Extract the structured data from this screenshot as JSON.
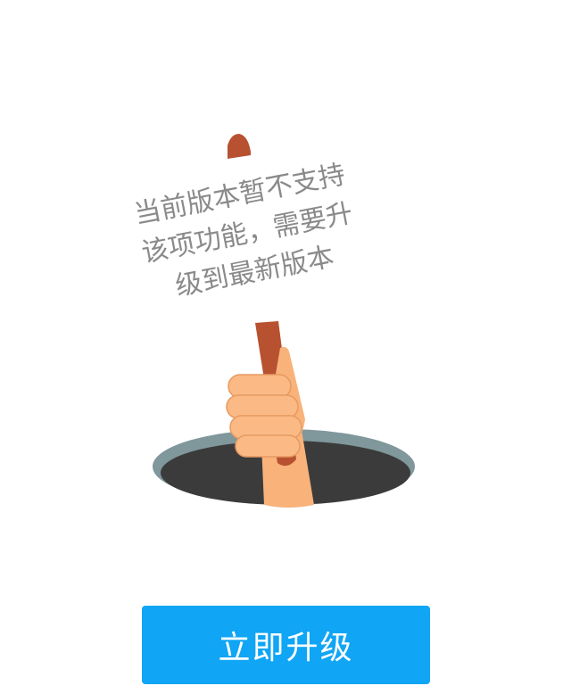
{
  "illustration": {
    "icon": "hand-holding-sign-from-hole",
    "sign_lines": [
      "当前版本暂不支持",
      "该项功能，需要升",
      "级到最新版本"
    ]
  },
  "upgrade_button": {
    "label": "立即升级",
    "color": "#10a5f5"
  }
}
